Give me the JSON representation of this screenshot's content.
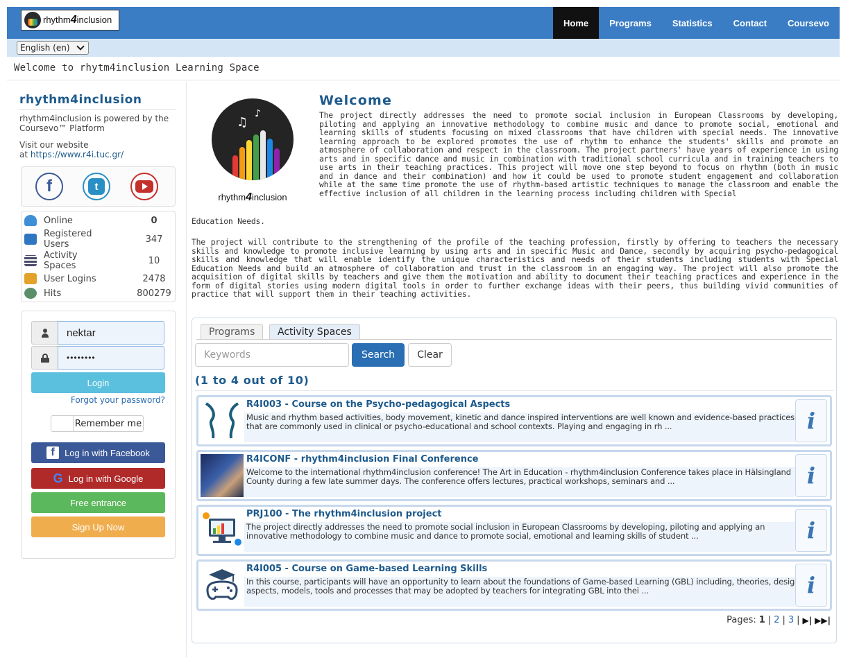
{
  "header": {
    "logo_text_pre": "rhythm",
    "logo_text_four": "4",
    "logo_text_post": "inclusion",
    "nav": [
      {
        "label": "Home",
        "active": true
      },
      {
        "label": "Programs",
        "active": false
      },
      {
        "label": "Statistics",
        "active": false
      },
      {
        "label": "Contact",
        "active": false
      },
      {
        "label": "Coursevo",
        "active": false
      }
    ],
    "language": "English (en)"
  },
  "welcome_line": "Welcome to rhytm4inclusion Learning Space",
  "sidebar": {
    "title": "rhythm4inclusion",
    "powered_line1": "rhythm4inclusion is powered by the",
    "powered_line2": "Coursevo™ Platform",
    "visit_line1": "Visit our website",
    "visit_prefix": "at",
    "website": "https://www.r4i.tuc.gr/",
    "social": [
      {
        "icon": "facebook-icon",
        "glyph": "f"
      },
      {
        "icon": "tumblr-icon",
        "glyph": "t"
      },
      {
        "icon": "youtube-icon",
        "glyph": ""
      }
    ],
    "stats": [
      {
        "label": "Online",
        "value": "0",
        "icon": "online-users-icon",
        "color": "#3f8fd8"
      },
      {
        "label": "Registered Users",
        "value": "347",
        "icon": "registered-users-icon",
        "color": "#2f76c2"
      },
      {
        "label": "Activity Spaces",
        "value": "10",
        "icon": "books-icon",
        "color": "#4a4a6a"
      },
      {
        "label": "User Logins",
        "value": "2478",
        "icon": "login-icon",
        "color": "#e3a22a"
      },
      {
        "label": "Hits",
        "value": "800279",
        "icon": "hits-icon",
        "color": "#5b8f6a"
      }
    ],
    "login": {
      "username": "nektar",
      "password_mask": "••••••••",
      "login_label": "Login",
      "forgot_label": "Forgot your password?",
      "remember_label": "Remember me",
      "facebook_label": "Log in with Facebook",
      "google_label": "Log in with Google",
      "free_label": "Free entrance",
      "signup_label": "Sign Up Now"
    }
  },
  "main": {
    "logo_pre": "rhythm",
    "logo_four": "4",
    "logo_post": "inclusion",
    "heading": "Welcome",
    "para1": "The project directly addresses the need to promote social inclusion in European Classrooms by developing, piloting and applying an innovative methodology to combine music and dance to promote social, emotional and learning skills of students focusing on mixed classrooms that have children with special needs. The innovative learning approach to be explored promotes the use of rhythm to enhance the students' skills and promote an atmosphere of collaboration and respect in the classroom. The project partners' have years of experience in using arts and in specific dance and music in combination with traditional school curricula and in training teachers to use arts in their teaching practices. This project will move one step beyond to focus on rhythm (both in music and in dance and their combination) and how it could be used to promote student engagement and collaboration while at the same time promote the use of rhythm-based artistic techniques to manage the classroom and enable the effective inclusion of all children in the learning process including children with Special",
    "para1_tail": "Education Needs.",
    "para2": "The project will contribute to the strengthening of the profile of the teaching profession, firstly by offering to teachers the necessary skills and knowledge to promote inclusive learning by using arts and in specific Music and Dance, secondly by acquiring psycho-pedagogical skills and knowledge that will enable identify the unique characteristics and needs of their students including students with Special Education Needs and build an atmosphere of collaboration and trust in the classroom in an engaging way. The project will also promote the acquisition of digital skills by teachers and give them the motivation and ability to document their teaching practices and experience in the form of digital stories using modern digital tools in order to further exchange ideas with their peers, thus building vivid communities of practice that will support them in their teaching activities."
  },
  "panel": {
    "tabs": [
      {
        "label": "Programs",
        "active": false
      },
      {
        "label": "Activity Spaces",
        "active": true
      }
    ],
    "search_placeholder": "Keywords",
    "search_label": "Search",
    "clear_label": "Clear",
    "result_count": "(1 to 4 out of 10)",
    "results": [
      {
        "title": "R4I003 - Course on the Psycho-pedagogical Aspects",
        "desc": "Music and rhythm based activities, body movement, kinetic and dance inspired interventions are well known and evidence-based practices that are commonly used in clinical or psycho-educational and school contexts. Playing and engaging in rh ...",
        "thumb": "faces-profile-thumbnail"
      },
      {
        "title": "R4ICONF - rhythm4inclusion Final Conference",
        "desc": "Welcome to the international rhythm4inclusion conference! The Art in Education - rhythm4inclusion Conference takes place in Hälsingland County during a few late summer days. The conference offers lectures, practical workshops, seminars and ...",
        "thumb": "conference-photo-thumbnail"
      },
      {
        "title": "PRJ100 - The rhythm4inclusion project",
        "desc": "The project directly addresses the need to promote social inclusion in European Classrooms by developing, piloting and applying an innovative methodology to combine music and dance to promote social, emotional and learning skills of student ...",
        "thumb": "computer-learning-thumbnail"
      },
      {
        "title": "R4I005 - Course on Game-based Learning Skills",
        "desc": "In this course, participants will have an opportunity to learn about the foundations of Game-based Learning (GBL) including, theories, design aspects, models, tools and processes that may be adopted by teachers for integrating GBL into thei ...",
        "thumb": "gamepad-graduation-thumbnail"
      }
    ],
    "pages_label": "Pages:",
    "pages": [
      "1",
      "2",
      "3"
    ],
    "info_glyph": "i"
  },
  "colors": {
    "brand_blue": "#3a7dc5",
    "heading_blue": "#1d5a8c",
    "login_blue": "#5bc0de",
    "facebook": "#3b5998",
    "google": "#b02a2a",
    "free": "#5cb85c",
    "signup": "#f0ad4e"
  }
}
